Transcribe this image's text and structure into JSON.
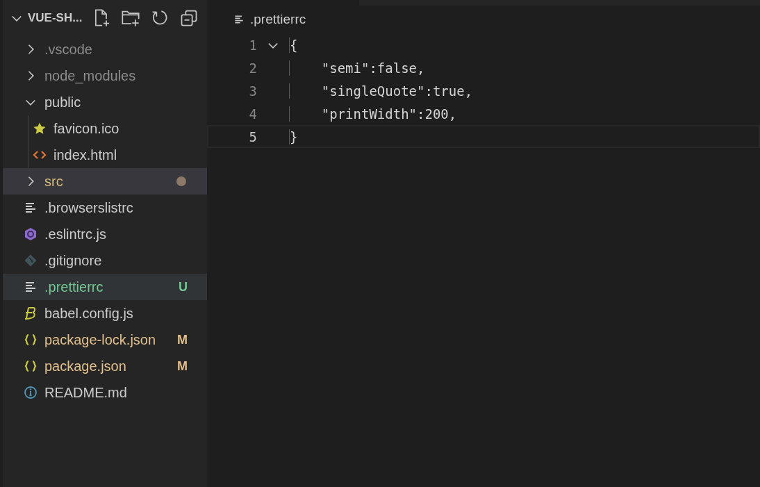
{
  "explorer": {
    "title": "VUE-SH...",
    "expanded": true
  },
  "tree": [
    {
      "kind": "folder",
      "label": ".vscode",
      "expanded": false,
      "dimmed": true,
      "selected": false,
      "hovered": false,
      "untracked": false,
      "modified": false,
      "has_changes": false
    },
    {
      "kind": "folder",
      "label": "node_modules",
      "expanded": false,
      "dimmed": true,
      "selected": false,
      "hovered": false,
      "untracked": false,
      "modified": false,
      "has_changes": false
    },
    {
      "kind": "folder",
      "label": "public",
      "expanded": true,
      "dimmed": false,
      "selected": false,
      "hovered": false,
      "untracked": false,
      "modified": false,
      "has_changes": false,
      "children": [
        {
          "kind": "star",
          "label": "favicon.ico",
          "dimmed": false,
          "selected": false,
          "hovered": false,
          "untracked": false,
          "modified": false,
          "has_changes": false
        },
        {
          "kind": "code",
          "label": "index.html",
          "dimmed": false,
          "selected": false,
          "hovered": false,
          "untracked": false,
          "modified": false,
          "has_changes": false
        }
      ]
    },
    {
      "kind": "folder",
      "label": "src",
      "expanded": false,
      "dimmed": false,
      "selected": true,
      "hovered": false,
      "untracked": false,
      "modified": false,
      "has_changes": true
    },
    {
      "kind": "text",
      "label": ".browserslistrc",
      "dimmed": false,
      "selected": false,
      "hovered": false,
      "untracked": false,
      "modified": false,
      "has_changes": false
    },
    {
      "kind": "eslint",
      "label": ".eslintrc.js",
      "dimmed": false,
      "selected": false,
      "hovered": false,
      "untracked": false,
      "modified": false,
      "has_changes": false
    },
    {
      "kind": "git",
      "label": ".gitignore",
      "dimmed": false,
      "selected": false,
      "hovered": false,
      "untracked": false,
      "modified": false,
      "has_changes": false
    },
    {
      "kind": "text",
      "label": ".prettierrc",
      "dimmed": false,
      "selected": false,
      "hovered": true,
      "untracked": true,
      "modified": false,
      "has_changes": false,
      "badge": "U"
    },
    {
      "kind": "babel",
      "label": "babel.config.js",
      "dimmed": false,
      "selected": false,
      "hovered": false,
      "untracked": false,
      "modified": false,
      "has_changes": false
    },
    {
      "kind": "json",
      "label": "package-lock.json",
      "dimmed": false,
      "selected": false,
      "hovered": false,
      "untracked": false,
      "modified": true,
      "has_changes": false,
      "badge": "M"
    },
    {
      "kind": "json",
      "label": "package.json",
      "dimmed": false,
      "selected": false,
      "hovered": false,
      "untracked": false,
      "modified": true,
      "has_changes": false,
      "badge": "M"
    },
    {
      "kind": "info",
      "label": "README.md",
      "dimmed": false,
      "selected": false,
      "hovered": false,
      "untracked": false,
      "modified": false,
      "has_changes": false
    }
  ],
  "editor": {
    "breadcrumb": ".prettierrc",
    "lines": [
      {
        "number": "1",
        "text": "{",
        "foldable": true,
        "current": false
      },
      {
        "number": "2",
        "text": "    \"semi\":false,",
        "foldable": false,
        "current": false
      },
      {
        "number": "3",
        "text": "    \"singleQuote\":true,",
        "foldable": false,
        "current": false
      },
      {
        "number": "4",
        "text": "    \"printWidth\":200,",
        "foldable": false,
        "current": false
      },
      {
        "number": "5",
        "text": "}",
        "foldable": false,
        "current": true
      }
    ]
  }
}
